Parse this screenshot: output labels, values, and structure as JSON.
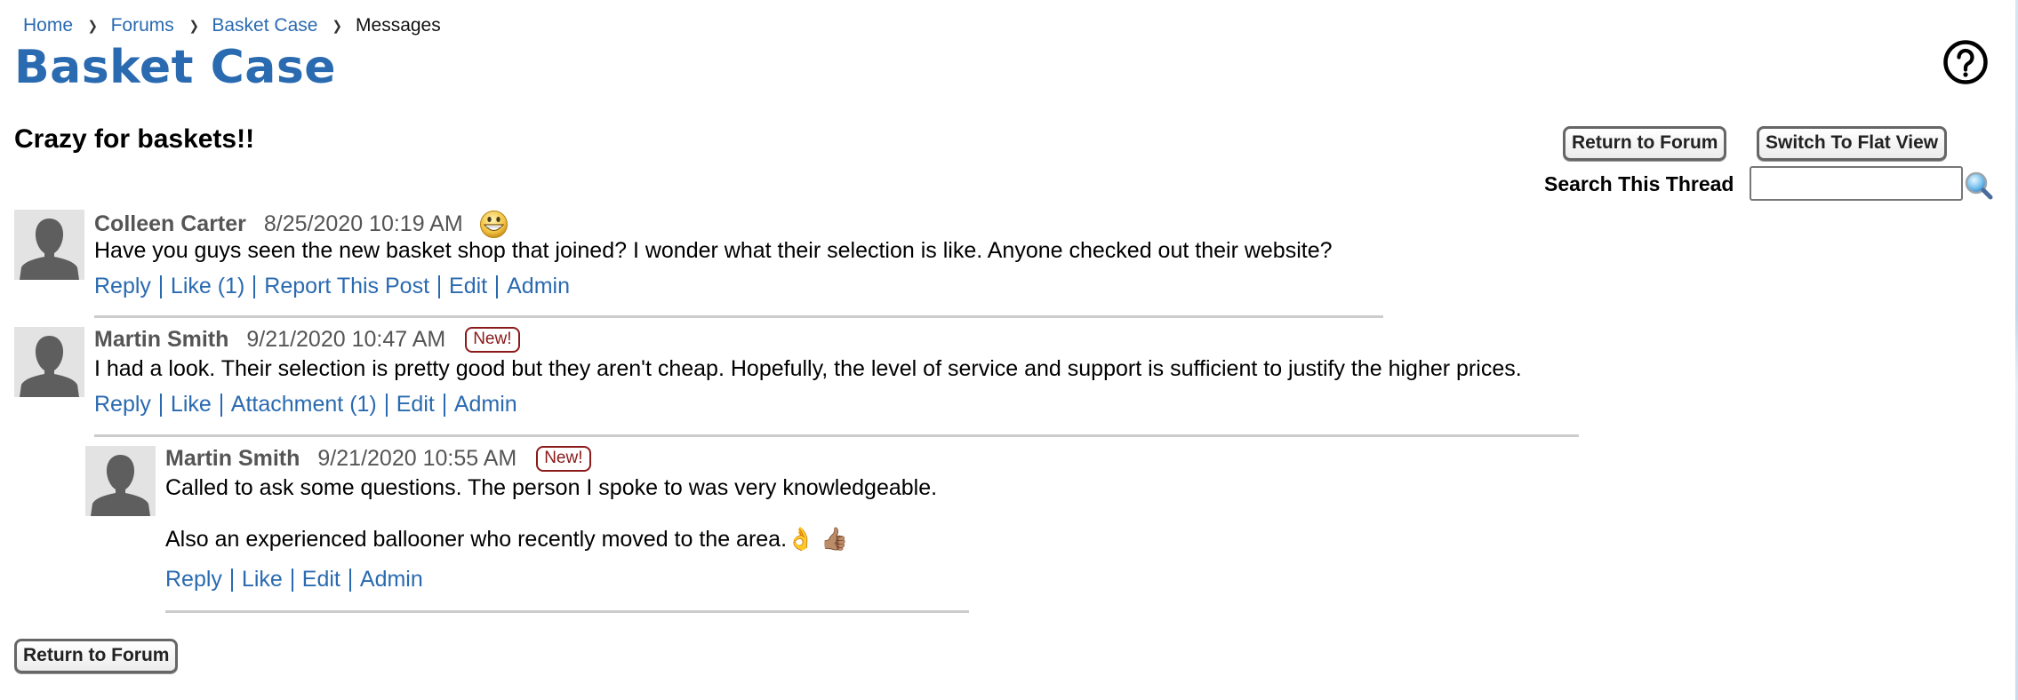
{
  "breadcrumb": [
    {
      "label": "Home",
      "link": true
    },
    {
      "label": "Forums",
      "link": true
    },
    {
      "label": "Basket Case",
      "link": true
    },
    {
      "label": "Messages",
      "link": false
    }
  ],
  "page": {
    "title": "Basket Case",
    "subtitle": "Crazy for baskets!!",
    "help_icon": "help-circle-icon"
  },
  "toolbar": {
    "return_label": "Return to Forum",
    "flat_view_label": "Switch To Flat View",
    "search_label": "Search This Thread",
    "search_value": "",
    "search_icon": "magnifier-icon"
  },
  "colors": {
    "link": "#2a6ab0",
    "title": "#2a6ab0",
    "new_badge": "#8b1a1a",
    "separator": "#cccccc"
  },
  "posts": [
    {
      "author": "Colleen Carter",
      "timestamp": "8/25/2020 10:19 AM",
      "emoticon": "grinning-face",
      "is_new": false,
      "body": [
        "Have you guys seen the new basket shop that joined? I wonder what their selection is like. Anyone checked out their website?"
      ],
      "actions": [
        "Reply",
        "Like (1)",
        "Report This Post",
        "Edit",
        "Admin"
      ]
    },
    {
      "author": "Martin Smith",
      "timestamp": "9/21/2020 10:47 AM",
      "is_new": true,
      "badge": "New!",
      "body": [
        "I had a look. Their selection is pretty good but they aren't cheap. Hopefully, the level of service and support is sufficient to justify the higher prices."
      ],
      "actions": [
        "Reply",
        "Like",
        "Attachment (1)",
        "Edit",
        "Admin"
      ]
    },
    {
      "author": "Martin Smith",
      "timestamp": "9/21/2020 10:55 AM",
      "is_new": true,
      "badge": "New!",
      "is_reply": true,
      "body": [
        "Called to ask some questions. The person I spoke to was very knowledgeable.",
        "Also an experienced ballooner who recently moved to the area.👌 👍🏽"
      ],
      "actions": [
        "Reply",
        "Like",
        "Edit",
        "Admin"
      ]
    }
  ],
  "footer": {
    "return_label": "Return to Forum"
  }
}
